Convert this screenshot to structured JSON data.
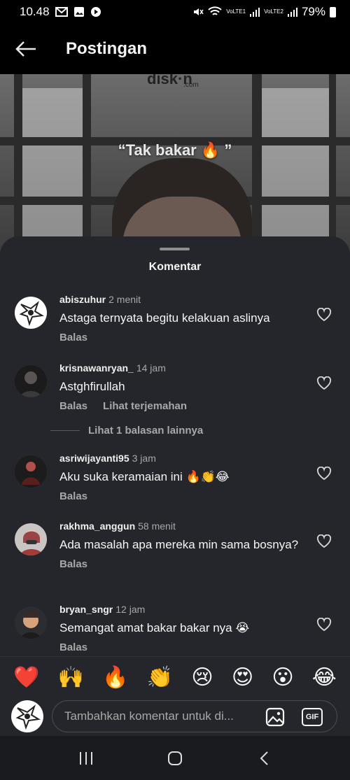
{
  "status_bar": {
    "time": "10.48",
    "carrier1": "VoLTE1",
    "carrier2": "VoLTE2",
    "battery": "79%"
  },
  "header": {
    "title": "Postingan"
  },
  "post": {
    "watermark": "disk·n",
    "watermark_sub": ".com",
    "overlay_text": "“Tak bakar 🔥 ”"
  },
  "comments_sheet": {
    "title": "Komentar",
    "comments": [
      {
        "username": "abiszuhur",
        "time": "2 menit",
        "text": "Astaga ternyata begitu kelakuan aslinya",
        "reply_label": "Balas",
        "translate_label": ""
      },
      {
        "username": "krisnawanryan_",
        "time": "14 jam",
        "text": "Astghfirullah",
        "reply_label": "Balas",
        "translate_label": "Lihat terjemahan"
      },
      {
        "username": "asriwijayanti95",
        "time": "3 jam",
        "text": "Aku suka keramaian ini 🔥👏😂",
        "reply_label": "Balas",
        "translate_label": ""
      },
      {
        "username": "rakhma_anggun",
        "time": "58 menit",
        "text": "Ada masalah apa mereka min sama bosnya?",
        "reply_label": "Balas",
        "translate_label": ""
      },
      {
        "username": "bryan_sngr",
        "time": "12 jam",
        "text": "Semangat amat bakar bakar nya 😭",
        "reply_label": "Balas",
        "translate_label": ""
      }
    ],
    "view_replies": "Lihat 1 balasan lainnya"
  },
  "emoji_bar": [
    "❤️",
    "🙌",
    "🔥",
    "👏",
    "😢",
    "😍",
    "😮",
    "😂"
  ],
  "input": {
    "placeholder": "Tambahkan komentar untuk di...",
    "gif_label": "GIF"
  },
  "colors": {
    "sheet_bg": "#24262b",
    "text_primary": "#f5f5f5",
    "text_secondary": "#a8a8a8"
  }
}
